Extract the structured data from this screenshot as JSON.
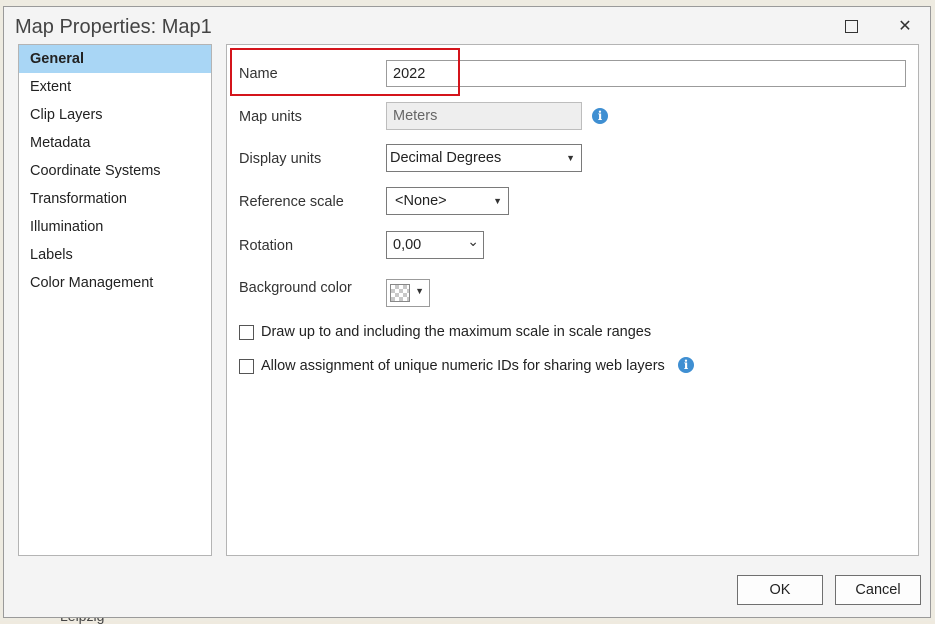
{
  "window": {
    "title": "Map Properties: Map1",
    "maximize_icon": "maximize-icon",
    "close_icon": "close-icon",
    "close_glyph": "✕"
  },
  "background": {
    "map_label": "Leipzig"
  },
  "nav": {
    "items": [
      {
        "label": "General",
        "selected": true
      },
      {
        "label": "Extent"
      },
      {
        "label": "Clip Layers"
      },
      {
        "label": "Metadata"
      },
      {
        "label": "Coordinate Systems"
      },
      {
        "label": "Transformation"
      },
      {
        "label": "Illumination"
      },
      {
        "label": "Labels"
      },
      {
        "label": "Color Management"
      }
    ]
  },
  "general": {
    "name_label": "Name",
    "name_value": "2022",
    "map_units_label": "Map units",
    "map_units_value": "Meters",
    "display_units_label": "Display units",
    "display_units_value": "Decimal Degrees",
    "reference_scale_label": "Reference scale",
    "reference_scale_value": "<None>",
    "rotation_label": "Rotation",
    "rotation_value": "0,00",
    "background_color_label": "Background color",
    "checkbox_max_scale": {
      "label": "Draw up to and including the maximum scale in scale ranges",
      "checked": false
    },
    "checkbox_unique_ids": {
      "label": "Allow assignment of unique numeric IDs for sharing web layers",
      "checked": false
    },
    "info_glyph": "i",
    "dropdown_glyph": "▼",
    "chevron_glyph": "⌄"
  },
  "buttons": {
    "ok": "OK",
    "cancel": "Cancel"
  },
  "colors": {
    "selection": "#a9d6f5",
    "highlight": "#d4141b",
    "info": "#3f8fd2"
  }
}
